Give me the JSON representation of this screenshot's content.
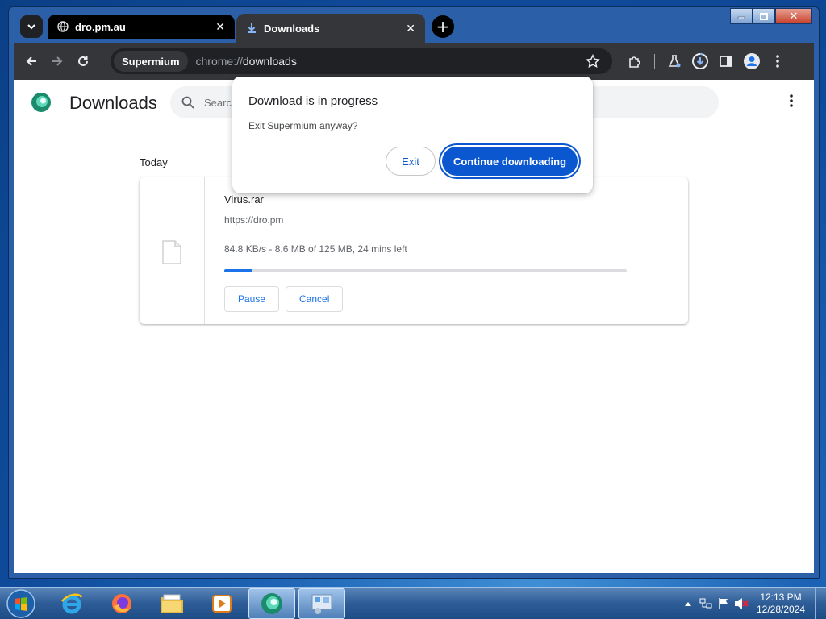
{
  "tabs": [
    {
      "title": "dro.pm.au",
      "icon": "globe-icon",
      "active": false
    },
    {
      "title": "Downloads",
      "icon": "download-icon",
      "active": true
    }
  ],
  "window_controls": {
    "minimize": "minimize-icon",
    "maximize": "maximize-icon",
    "close": "close-icon"
  },
  "omnibox": {
    "chip": "Supermium",
    "url_scheme": "chrome://",
    "url_host": "downloads"
  },
  "page": {
    "title": "Downloads",
    "search_placeholder": "Search downloads",
    "section_label": "Today"
  },
  "download": {
    "file_name": "Virus.rar",
    "source_url": "https://dro.pm",
    "status": "84.8 KB/s - 8.6 MB of 125 MB, 24 mins left",
    "progress_percent": 6.9,
    "pause_label": "Pause",
    "cancel_label": "Cancel"
  },
  "dialog": {
    "title": "Download is in progress",
    "body": "Exit Supermium anyway?",
    "exit_label": "Exit",
    "continue_label": "Continue downloading"
  },
  "taskbar": {
    "apps": [
      "internet-explorer-icon",
      "firefox-icon",
      "file-explorer-icon",
      "media-player-icon",
      "supermium-icon",
      "control-panel-icon"
    ],
    "time": "12:13 PM",
    "date": "12/28/2024"
  },
  "colors": {
    "accent": "#0b57d0",
    "link_blue": "#1a73e8",
    "toolbar": "#35363a",
    "tab_strip": "#2b5fa8"
  }
}
